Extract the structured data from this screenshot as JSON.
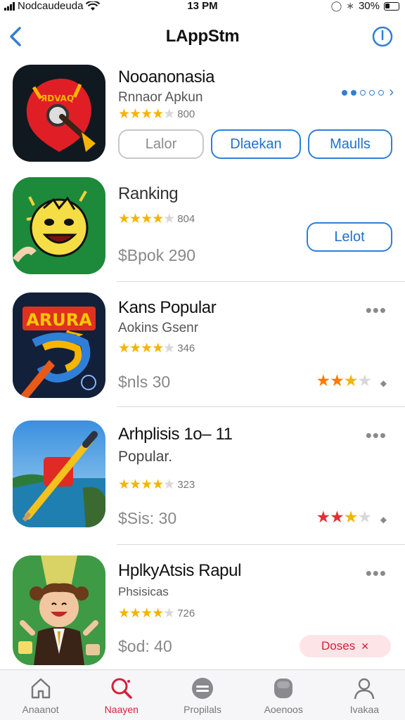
{
  "status_bar": {
    "carrier": "Nodcaudeuda",
    "time": "13 PM",
    "battery": "30%"
  },
  "nav": {
    "back_icon": "chevron-left-icon",
    "title": "LAppStm",
    "info_icon": "info-circle-icon"
  },
  "apps": [
    {
      "name": "Nooanonasia",
      "subtitle": "Rnnaor Apkun",
      "rating_count": "800",
      "buttons": [
        "Lalor",
        "Dlaekan",
        "Maulls"
      ]
    },
    {
      "name": "Ranking",
      "rating_count": "804",
      "price": "$Bpok 290",
      "button": "Lelot"
    },
    {
      "name": "Kans Popular",
      "subtitle": "Aokins Gsenr",
      "rating_count": "346",
      "price": "$nls 30"
    },
    {
      "name": "Arhplisis 1o– 11",
      "subtitle": "Popular.",
      "rating_count": "323",
      "price": "$Sis: 30"
    },
    {
      "name": "HplkyAtsis Rapul",
      "subtitle": "Phsisicas",
      "rating_count": "726",
      "price": "$od: 40",
      "badge": "Doses"
    }
  ],
  "tabs": [
    {
      "label": "Anaanot",
      "icon": "home-icon",
      "active": false
    },
    {
      "label": "Naayen",
      "icon": "search-icon",
      "active": true
    },
    {
      "label": "Propilals",
      "icon": "stack-icon",
      "active": false
    },
    {
      "label": "Aoenoos",
      "icon": "apps-icon",
      "active": false
    },
    {
      "label": "Ivakaa",
      "icon": "person-icon",
      "active": false
    }
  ],
  "colors": {
    "accent_blue": "#2f7fd8",
    "star_yellow": "#f4b400",
    "active_red": "#d61f3a"
  }
}
